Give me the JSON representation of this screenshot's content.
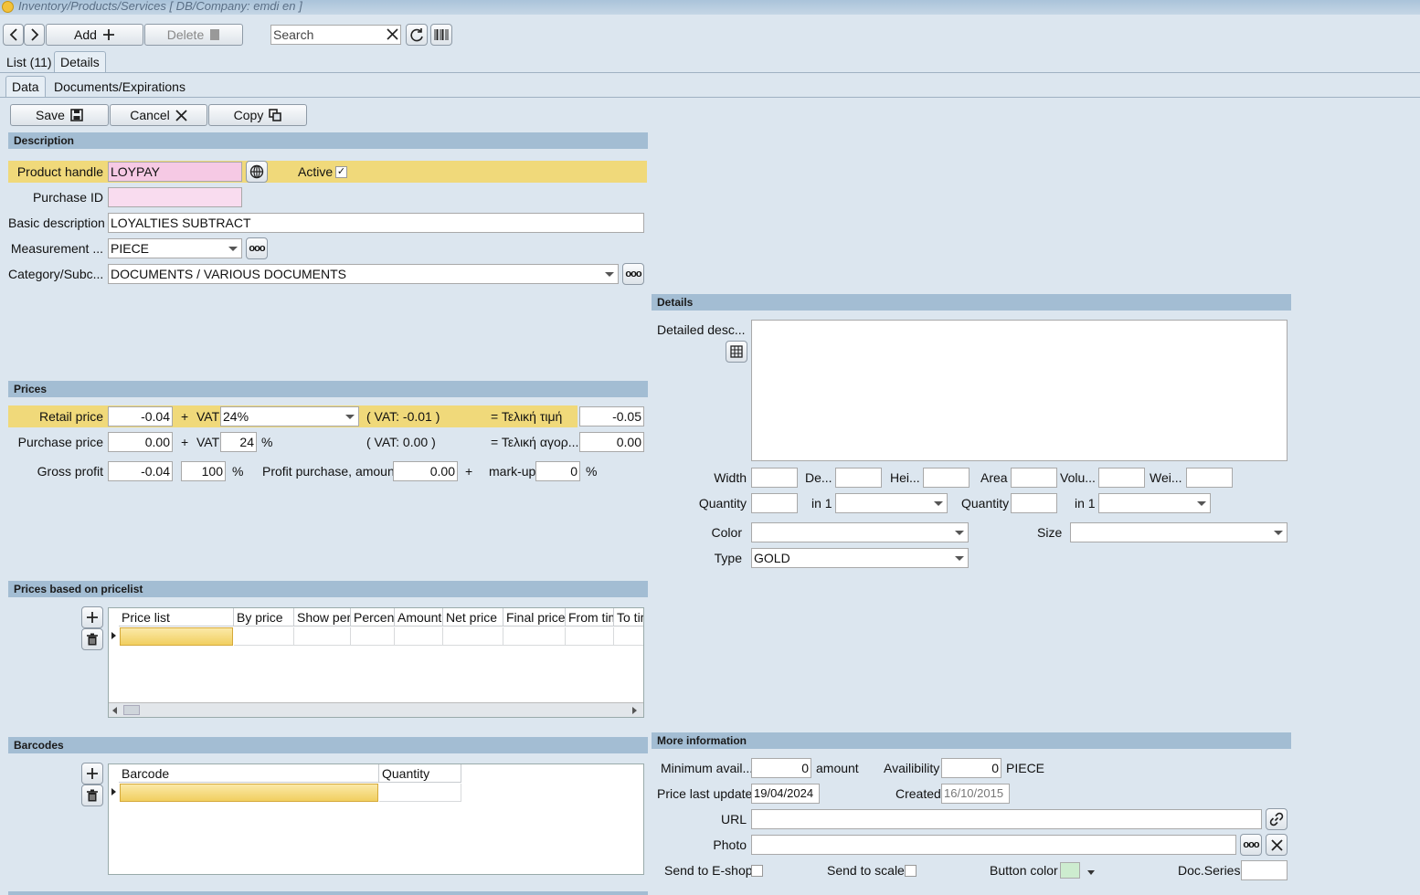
{
  "window": {
    "title": "Inventory/Products/Services   [ DB/Company: emdi en ]"
  },
  "toolbar": {
    "add_label": "Add",
    "delete_label": "Delete",
    "search_placeholder": "Search"
  },
  "tabs": {
    "list": "List (11)",
    "details": "Details"
  },
  "subtabs": {
    "data": "Data",
    "documents": "Documents/Expirations"
  },
  "actions": {
    "save": "Save",
    "cancel": "Cancel",
    "copy": "Copy"
  },
  "description": {
    "header": "Description",
    "product_handle_label": "Product handle",
    "product_handle": "LOYPAY",
    "active_label": "Active",
    "active_checked": true,
    "purchase_id_label": "Purchase ID",
    "purchase_id": "",
    "basic_description_label": "Basic description",
    "basic_description": "LOYALTIES SUBTRACT",
    "measurement_label": "Measurement ...",
    "measurement": "PIECE",
    "category_label": "Category/Subc...",
    "category": "DOCUMENTS / VARIOUS DOCUMENTS"
  },
  "prices": {
    "header": "Prices",
    "retail_label": "Retail price",
    "retail_value": "-0.04",
    "plus": "+",
    "vat_label": "VAT",
    "retail_vat": "24%",
    "retail_vat_amount": "( VAT: -0.01 )",
    "final_label": "= Τελική τιμή",
    "final_value": "-0.05",
    "purchase_label": "Purchase price",
    "purchase_value": "0.00",
    "purchase_vat": "24",
    "percent": "%",
    "purchase_vat_amount": "( VAT: 0.00 )",
    "purchase_final_label": "= Τελική αγορ...",
    "purchase_final_value": "0.00",
    "gross_label": "Gross profit",
    "gross_value": "-0.04",
    "gross_percent": "100",
    "profit_purchase_label": "Profit purchase, amount",
    "profit_purchase_value": "0.00",
    "markup_label": "mark-up",
    "markup_value": "0"
  },
  "pricelist": {
    "header": "Prices based on pricelist",
    "columns": [
      "Price list",
      "By price",
      "Show perc",
      "Percent",
      "Amount",
      "Net price",
      "Final price",
      "From tim",
      "To tim"
    ]
  },
  "barcodes": {
    "header": "Barcodes",
    "columns": [
      "Barcode",
      "Quantity"
    ]
  },
  "details": {
    "header": "Details",
    "detailed_desc_label": "Detailed desc...",
    "width_label": "Width",
    "depth_label": "De...",
    "height_label": "Hei...",
    "area_label": "Area",
    "volume_label": "Volu...",
    "weight_label": "Wei...",
    "quantity_label": "Quantity",
    "in1_label": "in 1",
    "color_label": "Color",
    "size_label": "Size",
    "type_label": "Type",
    "type_value": "GOLD"
  },
  "more": {
    "header": "More information",
    "min_avail_label": "Minimum avail...",
    "min_avail_value": "0",
    "amount_label": "amount",
    "availability_label": "Availibility",
    "availability_value": "0",
    "availability_unit": "PIECE",
    "price_update_label": "Price last update",
    "price_update_value": "19/04/2024",
    "created_label": "Created",
    "created_value": "16/10/2015",
    "url_label": "URL",
    "photo_label": "Photo",
    "eshop_label": "Send to E-shop",
    "scale_label": "Send to scale",
    "button_color_label": "Button color",
    "button_color": "#cdeccf",
    "docseries_label": "Doc.Series"
  },
  "colors": {
    "highlight": "#f0d97a",
    "section": "#a3bdd3",
    "pink": "#f6c9e4",
    "background": "#dce6ef"
  }
}
